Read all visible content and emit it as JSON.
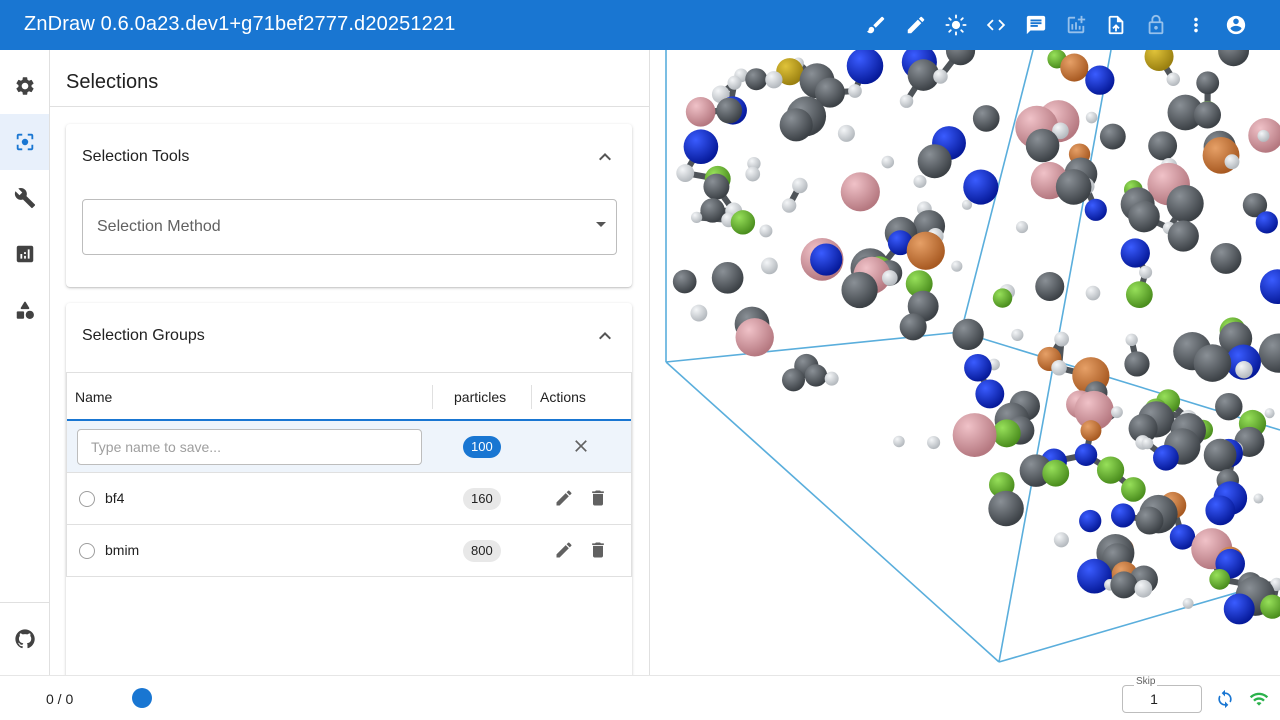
{
  "app": {
    "title": "ZnDraw 0.6.0a23.dev1+g71bef2777.d20251221"
  },
  "toolbar": {
    "icons": [
      "brush-icon",
      "pencil-icon",
      "brightness-icon",
      "code-icon",
      "chat-icon",
      "add-chart-icon",
      "upload-file-icon",
      "lock-icon",
      "more-vert-icon",
      "account-icon"
    ]
  },
  "rail": {
    "items": [
      "settings-icon",
      "selection-icon",
      "wrench-icon",
      "analytics-icon",
      "geometry-icon",
      "github-icon"
    ],
    "active": "selection-icon"
  },
  "panel": {
    "title": "Selections",
    "selection_tools": {
      "header": "Selection Tools",
      "method_label": "Selection Method"
    },
    "selection_groups": {
      "header": "Selection Groups",
      "columns": {
        "name": "Name",
        "particles": "particles",
        "actions": "Actions"
      },
      "new_group": {
        "placeholder": "Type name to save...",
        "count": "100"
      },
      "rows": [
        {
          "name": "bf4",
          "count": "160"
        },
        {
          "name": "bmim",
          "count": "800"
        }
      ]
    }
  },
  "bottom": {
    "frame_counter": "0 / 0",
    "skip_label": "Skip",
    "skip_value": "1"
  },
  "colors": {
    "primary": "#1976d2",
    "carbon": "#4f5459",
    "hydrogen": "#d0d4d8",
    "nitrogen": "#0a2ad0",
    "fluorine": "#6ab82f",
    "boron": "#d49aa2",
    "cell": "#5aaedc",
    "wifi": "#2bb24c"
  }
}
